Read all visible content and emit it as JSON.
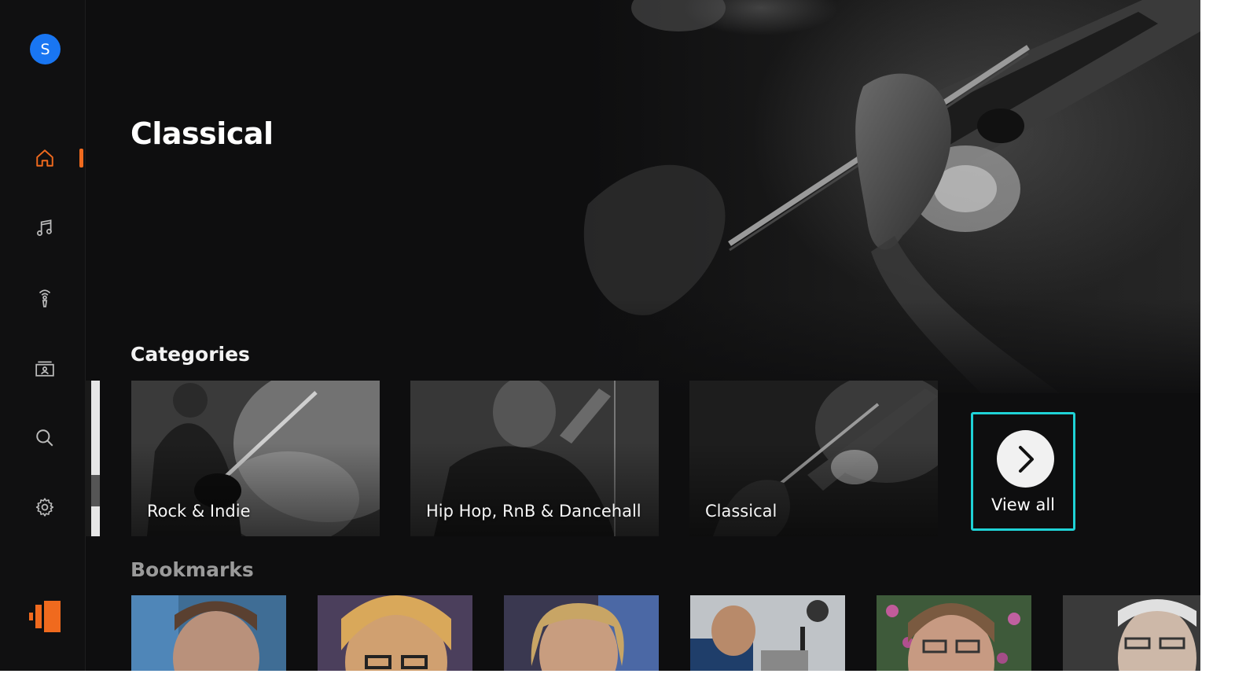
{
  "user": {
    "avatar_initial": "S"
  },
  "sidebar": {
    "items": [
      {
        "name": "home",
        "icon": "home-icon",
        "active": true
      },
      {
        "name": "music",
        "icon": "music-note-icon",
        "active": false
      },
      {
        "name": "podcasts",
        "icon": "podcast-icon",
        "active": false
      },
      {
        "name": "library",
        "icon": "library-icon",
        "active": false
      },
      {
        "name": "search",
        "icon": "search-icon",
        "active": false
      },
      {
        "name": "settings",
        "icon": "gear-icon",
        "active": false
      }
    ],
    "brand_icon": "brand-logo-icon"
  },
  "hero": {
    "title": "Classical"
  },
  "categories": {
    "heading": "Categories",
    "items": [
      {
        "label": "Rock & Indie"
      },
      {
        "label": "Hip Hop, RnB & Dancehall"
      },
      {
        "label": "Classical"
      }
    ],
    "view_all_label": "View all"
  },
  "bookmarks": {
    "heading": "Bookmarks",
    "count_visible": 6
  },
  "colors": {
    "accent": "#f06a1e",
    "focus": "#1fd2d6",
    "avatar": "#1976f2",
    "background": "#0e0e0f"
  }
}
